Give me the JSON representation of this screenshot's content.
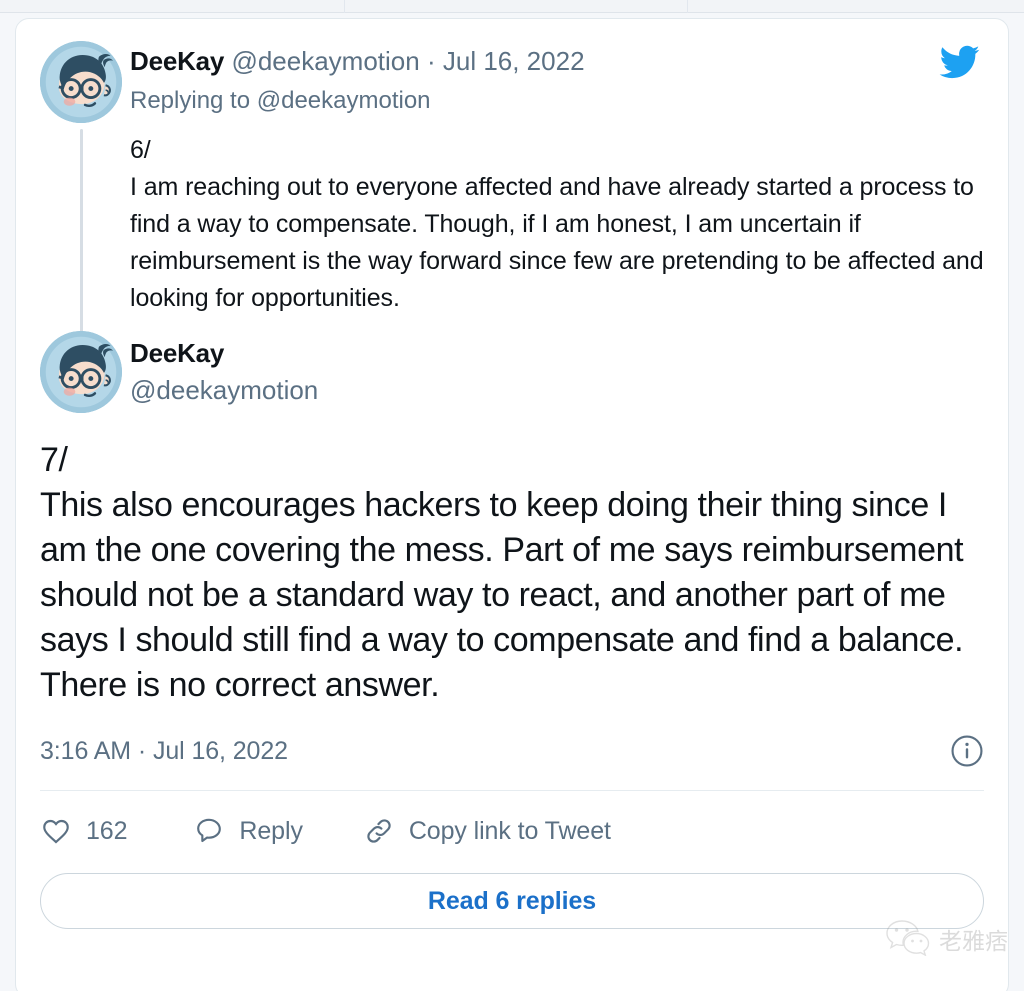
{
  "card": {
    "brand_icon": "twitter-bird-icon",
    "brand_color": "#1da1f2"
  },
  "tweet_reply": {
    "avatar_alt": "deekay-avatar",
    "display_name": "DeeKay",
    "handle": "@deekaymotion",
    "separator": "·",
    "date": "Jul 16, 2022",
    "replying_to": "Replying to @deekaymotion",
    "sequence": "6/",
    "body": "I am reaching out to everyone affected and have already started a process to find a way to compensate. Though, if I am honest, I am uncertain if reimbursement is the way forward since few are pretending to be affected and looking for opportunities."
  },
  "tweet_main": {
    "avatar_alt": "deekay-avatar",
    "display_name": "DeeKay",
    "handle": "@deekaymotion",
    "sequence": "7/",
    "body": "This also encourages hackers to keep doing their thing since I am the one covering the mess. Part of me says reimbursement should not be a standard way to react, and another part of me says I should still find a way to compensate and find a balance. There is no correct answer.",
    "timestamp": "3:16 AM · Jul 16, 2022",
    "info_icon": "info-circle-icon"
  },
  "actions": {
    "like": {
      "icon": "heart-icon",
      "count": "162"
    },
    "reply": {
      "icon": "speech-bubble-icon",
      "label": "Reply"
    },
    "copy_link": {
      "icon": "link-icon",
      "label": "Copy link to Tweet"
    }
  },
  "read_replies": {
    "label": "Read 6 replies"
  },
  "watermark": {
    "icon": "wechat-icon",
    "text": "老雅痞"
  }
}
